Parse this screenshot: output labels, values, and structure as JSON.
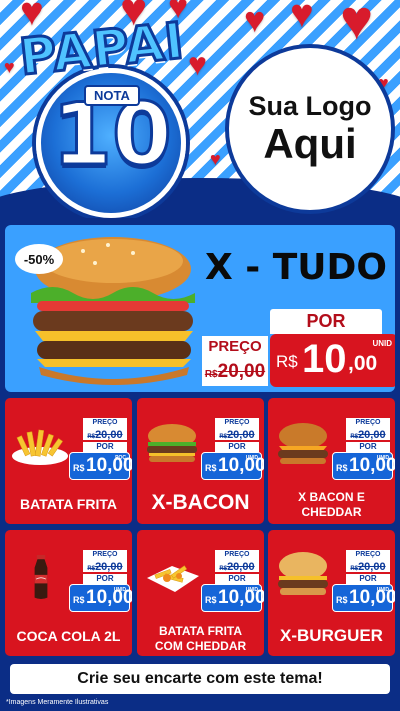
{
  "header": {
    "badge_top": "PAPAI",
    "badge_mid": "NOTA",
    "badge_num": "10",
    "logo_line1": "Sua Logo",
    "logo_line2": "Aqui"
  },
  "featured": {
    "discount": "-50%",
    "title": "X - TUDO",
    "preco_label": "PREÇO",
    "old_currency": "R$",
    "old_value": "20,00",
    "por_label": "POR",
    "currency": "R$",
    "price_int": "10",
    "price_dec": ",00",
    "unit": "UNID"
  },
  "products": [
    {
      "name_l1": "BATATA FRITA",
      "name_l2": "",
      "preco_label": "PREÇO",
      "old_currency": "R$",
      "old_value": "20,00",
      "por_label": "POR",
      "currency": "R$",
      "price": "10,00",
      "unit": "POÇ",
      "icon": "fries-icon"
    },
    {
      "name_l1": "X-BACON",
      "name_l2": "",
      "preco_label": "PREÇO",
      "old_currency": "R$",
      "old_value": "20,00",
      "por_label": "POR",
      "currency": "R$",
      "price": "10,00",
      "unit": "UNID",
      "icon": "burger-icon"
    },
    {
      "name_l1": "X BACON E",
      "name_l2": "CHEDDAR",
      "preco_label": "PREÇO",
      "old_currency": "R$",
      "old_value": "20,00",
      "por_label": "POR",
      "currency": "R$",
      "price": "10,00",
      "unit": "UNID",
      "icon": "burger-icon"
    },
    {
      "name_l1": "COCA COLA 2L",
      "name_l2": "",
      "preco_label": "PREÇO",
      "old_currency": "R$",
      "old_value": "20,00",
      "por_label": "POR",
      "currency": "R$",
      "price": "10,00",
      "unit": "UNID",
      "icon": "soda-bottle-icon"
    },
    {
      "name_l1": "BATATA FRITA",
      "name_l2": "COM CHEDDAR",
      "preco_label": "PREÇO",
      "old_currency": "R$",
      "old_value": "20,00",
      "por_label": "POR",
      "currency": "R$",
      "price": "10,00",
      "unit": "UNID",
      "icon": "fries-cheddar-icon"
    },
    {
      "name_l1": "X-BURGUER",
      "name_l2": "",
      "preco_label": "PREÇO",
      "old_currency": "R$",
      "old_value": "20,00",
      "por_label": "POR",
      "currency": "R$",
      "price": "10,00",
      "unit": "UNID",
      "icon": "burger-icon"
    }
  ],
  "footer": {
    "cta": "Crie seu encarte com este tema!",
    "disclaimer": "*Imagens Meramente Ilustrativas"
  },
  "colors": {
    "primary_blue": "#0b2d86",
    "light_blue": "#3aa0ff",
    "red": "#d8141f",
    "price_blue": "#1565d8"
  }
}
